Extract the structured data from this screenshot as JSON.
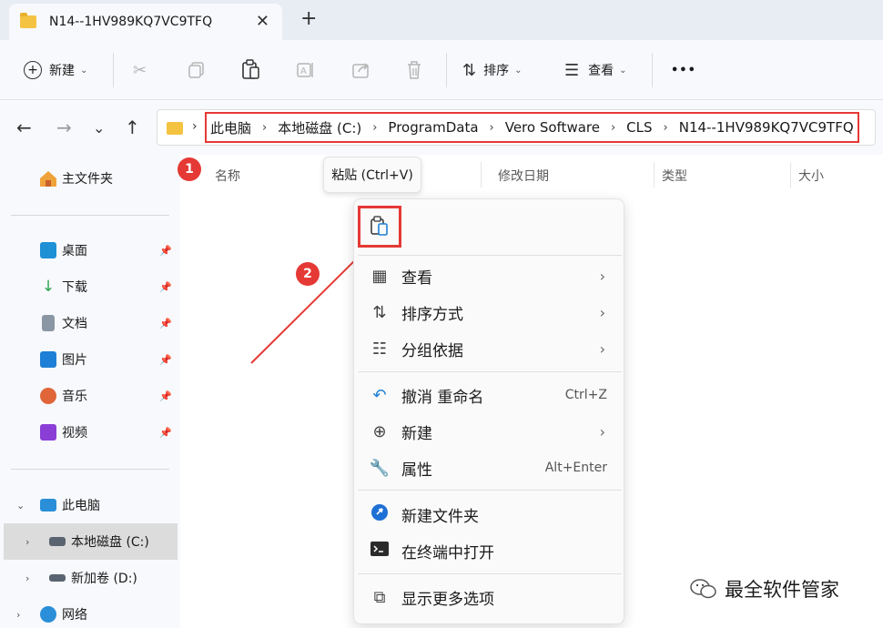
{
  "tab": {
    "title": "N14--1HV989KQ7VC9TFQ",
    "close": "✕",
    "new_tab": "+"
  },
  "toolbar": {
    "new_label": "新建",
    "sort_label": "排序",
    "view_label": "查看",
    "more": "•••"
  },
  "address": {
    "crumbs": [
      "此电脑",
      "本地磁盘 (C:)",
      "ProgramData",
      "Vero Software",
      "CLS",
      "N14--1HV989KQ7VC9TFQ"
    ]
  },
  "sidebar": {
    "home": "主文件夹",
    "quick": [
      {
        "label": "桌面",
        "icon": "desktop-icon",
        "color": "#1e90d6"
      },
      {
        "label": "下载",
        "icon": "download-icon",
        "color": "#2ea44f"
      },
      {
        "label": "文档",
        "icon": "document-icon",
        "color": "#7b8794"
      },
      {
        "label": "图片",
        "icon": "pictures-icon",
        "color": "#1e7fd6"
      },
      {
        "label": "音乐",
        "icon": "music-icon",
        "color": "#e0663a"
      },
      {
        "label": "视频",
        "icon": "video-icon",
        "color": "#8a3ed6"
      }
    ],
    "this_pc": "此电脑",
    "drive_c": "本地磁盘 (C:)",
    "drive_d": "新加卷 (D:)",
    "network": "网络"
  },
  "columns": {
    "name": "名称",
    "modified": "修改日期",
    "type": "类型",
    "size": "大小"
  },
  "badges": {
    "one": "1",
    "two": "2"
  },
  "tooltip": "粘贴 (Ctrl+V)",
  "menu": {
    "view": "查看",
    "sort": "排序方式",
    "group": "分组依据",
    "undo": "撤消 重命名",
    "undo_shortcut": "Ctrl+Z",
    "new": "新建",
    "properties": "属性",
    "properties_shortcut": "Alt+Enter",
    "new_folder": "新建文件夹",
    "terminal": "在终端中打开",
    "more_options": "显示更多选项"
  },
  "watermark": "最全软件管家",
  "colors": {
    "highlight": "#e53935",
    "folder": "#f5c342"
  }
}
